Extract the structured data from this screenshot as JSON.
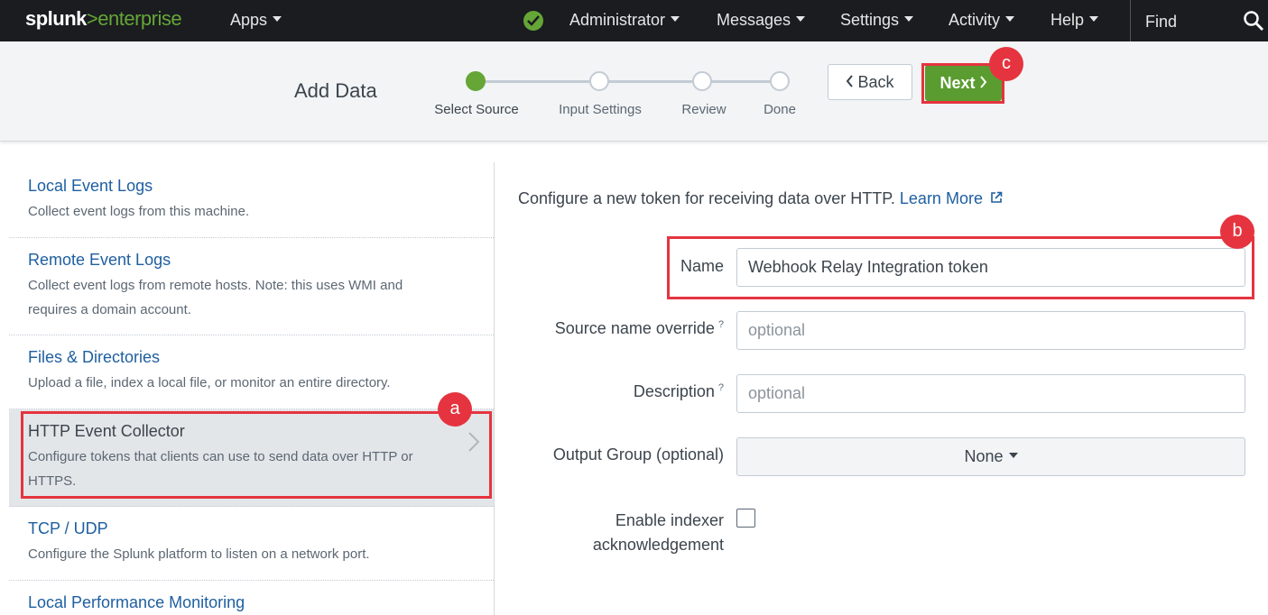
{
  "topnav": {
    "brand_main": "splunk",
    "brand_gt": ">",
    "brand_product": "enterprise",
    "apps": "Apps",
    "admin": "Administrator",
    "messages": "Messages",
    "settings": "Settings",
    "activity": "Activity",
    "help": "Help",
    "find_placeholder": "Find",
    "status_icon": "check-circle-icon",
    "status_color": "#65a637"
  },
  "header": {
    "title": "Add Data",
    "steps": [
      {
        "label": "Select Source",
        "active": true
      },
      {
        "label": "Input Settings",
        "active": false
      },
      {
        "label": "Review",
        "active": false
      },
      {
        "label": "Done",
        "active": false
      }
    ],
    "back_label": "Back",
    "next_label": "Next",
    "next_color": "#5a9c30"
  },
  "annotations": {
    "a": "a",
    "b": "b",
    "c": "c",
    "color": "#e5343f"
  },
  "sources": [
    {
      "title": "Local Event Logs",
      "desc": "Collect event logs from this machine."
    },
    {
      "title": "Remote Event Logs",
      "desc": "Collect event logs from remote hosts. Note: this uses WMI and requires a domain account."
    },
    {
      "title": "Files & Directories",
      "desc": "Upload a file, index a local file, or monitor an entire directory."
    },
    {
      "title": "HTTP Event Collector",
      "desc": "Configure tokens that clients can use to send data over HTTP or HTTPS.",
      "selected": true
    },
    {
      "title": "TCP / UDP",
      "desc": "Configure the Splunk platform to listen on a network port."
    },
    {
      "title": "Local Performance Monitoring",
      "desc": ""
    }
  ],
  "form": {
    "intro_text": "Configure a new token for receiving data over HTTP.",
    "learn_more": "Learn More",
    "name_label": "Name",
    "name_value": "Webhook Relay Integration token",
    "source_label": "Source name override",
    "source_placeholder": "optional",
    "description_label": "Description",
    "description_placeholder": "optional",
    "help_mark": "?",
    "output_label": "Output Group (optional)",
    "output_value": "None",
    "indexer_label_line1": "Enable indexer",
    "indexer_label_line2": "acknowledgement"
  }
}
